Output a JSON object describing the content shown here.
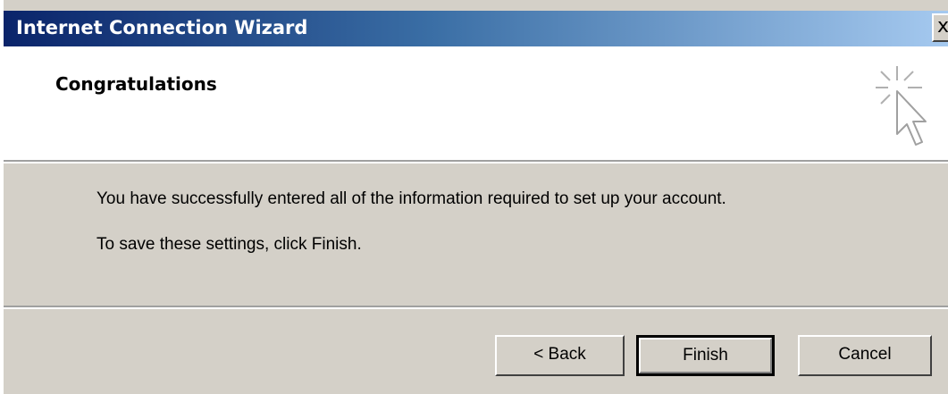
{
  "window": {
    "title": "Internet Connection Wizard",
    "close_label": "x"
  },
  "header": {
    "title": "Congratulations",
    "icon": "wizard-cursor-icon"
  },
  "body": {
    "line1": "You have successfully entered all of the information required to set up your account.",
    "line2": "To save these settings, click Finish."
  },
  "buttons": {
    "back_label": "< Back",
    "finish_label": "Finish",
    "cancel_label": "Cancel"
  },
  "colors": {
    "titlebar_start": "#0a246a",
    "titlebar_end": "#a6caf0",
    "dialog_bg": "#d4d0c8",
    "header_bg": "#ffffff"
  }
}
